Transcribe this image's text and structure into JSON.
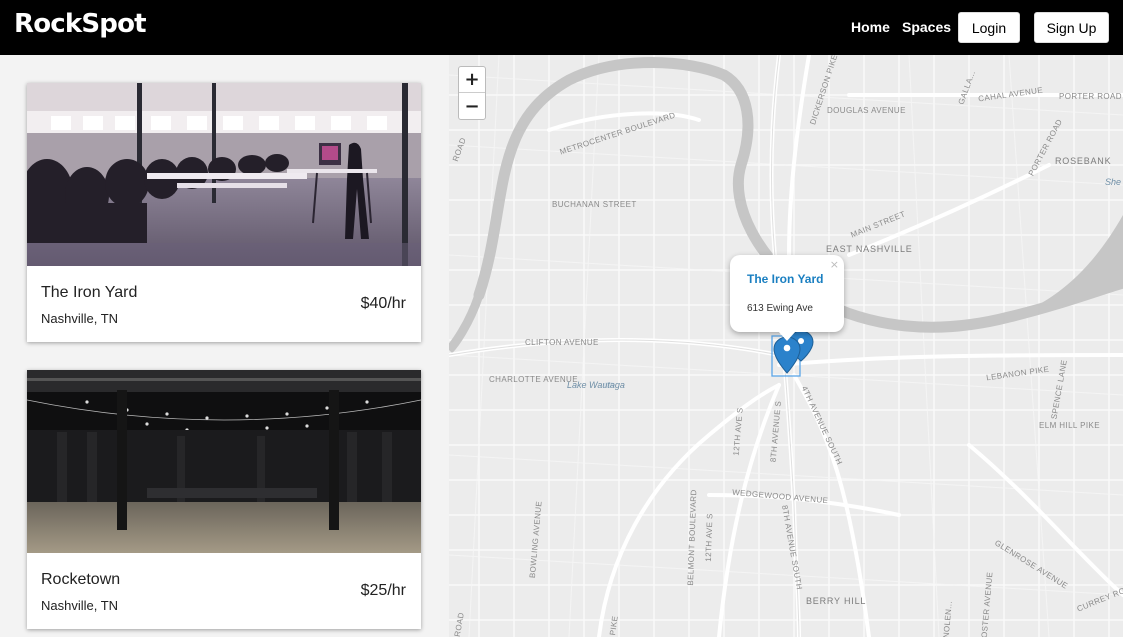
{
  "app": {
    "brand": "RockSpot"
  },
  "nav": {
    "home": "Home",
    "spaces": "Spaces",
    "login": "Login",
    "signup": "Sign Up"
  },
  "listings": [
    {
      "name": "The Iron Yard",
      "city": "Nashville, TN",
      "price": "$40/hr"
    },
    {
      "name": "Rocketown",
      "city": "Nashville, TN",
      "price": "$25/hr"
    }
  ],
  "map": {
    "zoom_in": "+",
    "zoom_out": "−",
    "popup": {
      "title": "The Iron Yard",
      "address": "613 Ewing Ave",
      "close": "×"
    },
    "marker_color": "#2b82cb",
    "labels": {
      "metrocenter": "METROCENTER BOULEVARD",
      "buchanan": "BUCHANAN STREET",
      "douglas": "DOUGLAS AVENUE",
      "dickerson": "DICKERSON PIKE",
      "cahal": "CAHAL AVENUE",
      "porter_road": "PORTER ROAD",
      "porter": "PORTER ROAD",
      "rosebank": "ROSEBANK",
      "she": "She",
      "gallatin": "GALLA...",
      "main": "MAIN STREET",
      "east_nashville": "EAST NASHVILLE",
      "clifton": "CLIFTON AVENUE",
      "charlotte": "CHARLOTTE AVENUE",
      "lake": "Lake Wautaga",
      "lebanon": "LEBANON PIKE",
      "spence": "SPENCE LANE",
      "elm": "ELM HILL PIKE",
      "fourth": "4TH AVENUE SOUTH",
      "eighth_top": "8TH AVENUE S",
      "twelfth_top": "12TH AVE S",
      "wedgewood": "WEDGEWOOD AVENUE",
      "bowling": "BOWLING AVENUE",
      "belmont": "BELMONT BOULEVARD",
      "twelfth": "12TH AVE S",
      "eighth": "8TH AVENUE SOUTH",
      "berry": "BERRY HILL",
      "glenrose": "GLENROSE AVENUE",
      "curry": "CURREY ROAD",
      "nolen": "NOLEN...",
      "foster": "FOSTER AVENUE",
      "road_top": "ROAD",
      "road_bottom": "ROAD",
      "pike_bottom": "PIKE"
    }
  }
}
